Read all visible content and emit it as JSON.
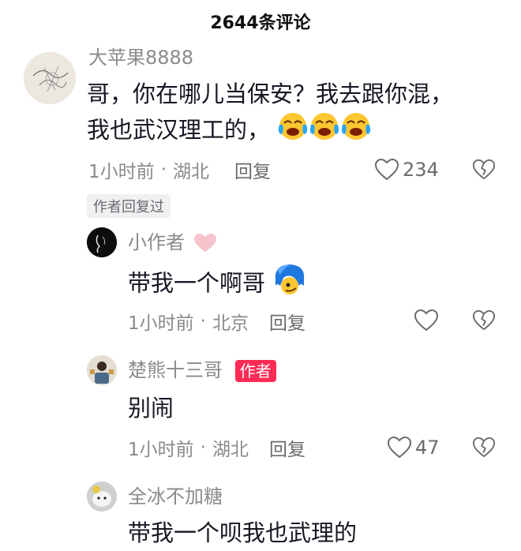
{
  "header": {
    "title": "2644条评论"
  },
  "comments": [
    {
      "username": "大苹果8888",
      "text_line1": "哥，你在哪儿当保安？我去跟你混，",
      "text_line2": "我也武汉理工的，",
      "time": "1小时前",
      "location": "湖北",
      "reply_label": "回复",
      "likes": "234",
      "author_replied": "作者回复过"
    }
  ],
  "replies": [
    {
      "username": "小作者",
      "text": "带我一个啊哥",
      "time": "1小时前",
      "location": "北京",
      "reply_label": "回复",
      "likes": ""
    },
    {
      "username": "楚熊十三哥",
      "badge": "作者",
      "text": "别闹",
      "time": "1小时前",
      "location": "湖北",
      "reply_label": "回复",
      "likes": "47"
    },
    {
      "username": "全冰不加糖",
      "text": "带我一个呗我也武理的"
    }
  ],
  "icons": {
    "like": "heart-outline-icon",
    "dislike": "broken-heart-icon",
    "emoji_crying": "crying-laughing-emoji",
    "emoji_blue_face": "blue-hair-face-emoji"
  },
  "colors": {
    "accent": "#fe2c55",
    "text": "#161823",
    "muted": "#8a8a8f"
  }
}
